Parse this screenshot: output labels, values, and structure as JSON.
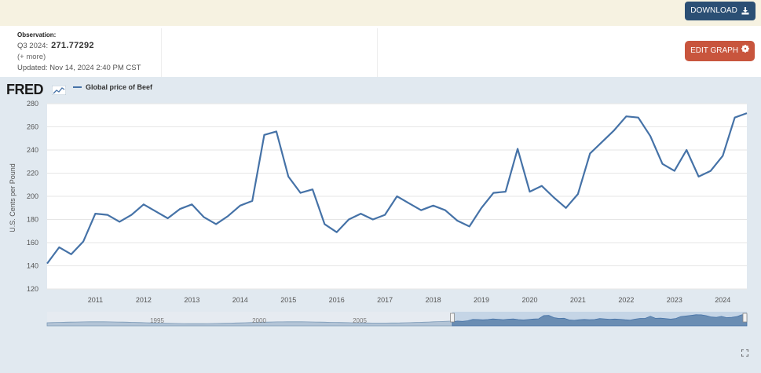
{
  "header": {
    "download_label": "DOWNLOAD",
    "observation_label": "Observation:",
    "obs_period": "Q3 2024:",
    "obs_value": "271.77292",
    "more_link": "(+ more)",
    "updated": "Updated: Nov 14, 2024 2:40 PM CST",
    "edit_graph_label": "EDIT GRAPH"
  },
  "brand": {
    "logo_text": "FRED"
  },
  "legend": {
    "series_name": "Global price of Beef"
  },
  "colors": {
    "series": "#4572a7",
    "download": "#2b4f74",
    "edit": "#c8553d",
    "panel": "#e1e9f0"
  },
  "icons": {
    "download": "download-icon",
    "gear": "gear-icon",
    "fullscreen": "fullscreen-icon"
  },
  "chart_data": {
    "type": "line",
    "title": "",
    "xlabel": "",
    "ylabel": "U.S. Cents per Pound",
    "ylim": [
      120,
      280
    ],
    "yticks": [
      120,
      140,
      160,
      180,
      200,
      220,
      240,
      260,
      280
    ],
    "xlim": [
      2010.0,
      2024.5
    ],
    "xticks": [
      2011,
      2012,
      2013,
      2014,
      2015,
      2016,
      2017,
      2018,
      2019,
      2020,
      2021,
      2022,
      2023,
      2024
    ],
    "grid": true,
    "legend_position": "top-left",
    "series": [
      {
        "name": "Global price of Beef",
        "frequency": "quarterly",
        "x": [
          "2010-Q1",
          "2010-Q2",
          "2010-Q3",
          "2010-Q4",
          "2011-Q1",
          "2011-Q2",
          "2011-Q3",
          "2011-Q4",
          "2012-Q1",
          "2012-Q2",
          "2012-Q3",
          "2012-Q4",
          "2013-Q1",
          "2013-Q2",
          "2013-Q3",
          "2013-Q4",
          "2014-Q1",
          "2014-Q2",
          "2014-Q3",
          "2014-Q4",
          "2015-Q1",
          "2015-Q2",
          "2015-Q3",
          "2015-Q4",
          "2016-Q1",
          "2016-Q2",
          "2016-Q3",
          "2016-Q4",
          "2017-Q1",
          "2017-Q2",
          "2017-Q3",
          "2017-Q4",
          "2018-Q1",
          "2018-Q2",
          "2018-Q3",
          "2018-Q4",
          "2019-Q1",
          "2019-Q2",
          "2019-Q3",
          "2019-Q4",
          "2020-Q1",
          "2020-Q2",
          "2020-Q3",
          "2020-Q4",
          "2021-Q1",
          "2021-Q2",
          "2021-Q3",
          "2021-Q4",
          "2022-Q1",
          "2022-Q2",
          "2022-Q3",
          "2022-Q4",
          "2023-Q1",
          "2023-Q2",
          "2023-Q3",
          "2023-Q4",
          "2024-Q1",
          "2024-Q2",
          "2024-Q3"
        ],
        "values": [
          142,
          156,
          150,
          161,
          185,
          184,
          178,
          184,
          193,
          187,
          181,
          189,
          193,
          182,
          176,
          183,
          192,
          196,
          253,
          256,
          217,
          203,
          206,
          176,
          169,
          180,
          185,
          180,
          184,
          200,
          194,
          188,
          192,
          188,
          179,
          174,
          190,
          203,
          204,
          241,
          204,
          209,
          199,
          190,
          202,
          237,
          247,
          257,
          269,
          268,
          252,
          228,
          222,
          240,
          217,
          222,
          235,
          268,
          271.77292
        ]
      }
    ],
    "navigator": {
      "labels": [
        "1995",
        "2000",
        "2005"
      ],
      "selected_start": "2010",
      "selected_end": "2024"
    }
  }
}
